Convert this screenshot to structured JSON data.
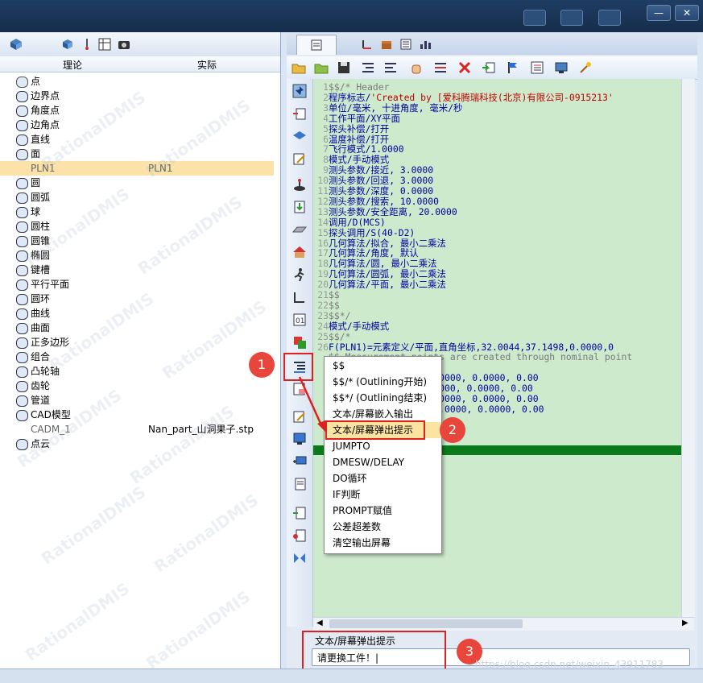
{
  "window": {
    "minimize": "—",
    "close": "✕"
  },
  "tree": {
    "col_theory": "理论",
    "col_actual": "实际",
    "rows": [
      {
        "label": "点",
        "actual": "",
        "indent": 0
      },
      {
        "label": "边界点",
        "actual": "",
        "indent": 0
      },
      {
        "label": "角度点",
        "actual": "",
        "indent": 0
      },
      {
        "label": "边角点",
        "actual": "",
        "indent": 0
      },
      {
        "label": "直线",
        "actual": "",
        "indent": 0
      },
      {
        "label": "面",
        "actual": "",
        "indent": 0
      },
      {
        "label": "PLN1",
        "actual": "PLN1",
        "indent": 1
      },
      {
        "label": "圆",
        "actual": "",
        "indent": 0
      },
      {
        "label": "圆弧",
        "actual": "",
        "indent": 0
      },
      {
        "label": "球",
        "actual": "",
        "indent": 0
      },
      {
        "label": "圆柱",
        "actual": "",
        "indent": 0
      },
      {
        "label": "圆锥",
        "actual": "",
        "indent": 0
      },
      {
        "label": "椭圆",
        "actual": "",
        "indent": 0
      },
      {
        "label": "键槽",
        "actual": "",
        "indent": 0
      },
      {
        "label": "平行平面",
        "actual": "",
        "indent": 0
      },
      {
        "label": "圆环",
        "actual": "",
        "indent": 0
      },
      {
        "label": "曲线",
        "actual": "",
        "indent": 0
      },
      {
        "label": "曲面",
        "actual": "",
        "indent": 0
      },
      {
        "label": "正多边形",
        "actual": "",
        "indent": 0
      },
      {
        "label": "组合",
        "actual": "",
        "indent": 0
      },
      {
        "label": "凸轮轴",
        "actual": "",
        "indent": 0
      },
      {
        "label": "齿轮",
        "actual": "",
        "indent": 0
      },
      {
        "label": "管道",
        "actual": "",
        "indent": 0
      },
      {
        "label": "CAD模型",
        "actual": "",
        "indent": 0
      },
      {
        "label": "CADM_1",
        "actual": "Nan_part_山洞果子.stp",
        "indent": 1
      },
      {
        "label": "点云",
        "actual": "",
        "indent": 0
      }
    ],
    "watermark": "RationalDMIS"
  },
  "editor": {
    "lines": [
      {
        "n": "1",
        "t": "$$/*  Header",
        "cls": "cmt"
      },
      {
        "n": "2",
        "t": "程序标志/",
        "s": "'Created by [爱科腾瑞科技(北京)有限公司-0915213'",
        "cls": "code"
      },
      {
        "n": "3",
        "t": "单位/毫米, 十进角度, 毫米/秒",
        "cls": "code"
      },
      {
        "n": "4",
        "t": "工作平面/XY平面",
        "cls": "code"
      },
      {
        "n": "5",
        "t": "探头补偿/打开",
        "cls": "code"
      },
      {
        "n": "6",
        "t": "温度补偿/打开",
        "cls": "code"
      },
      {
        "n": "7",
        "t": "飞行模式/1.0000",
        "cls": "code"
      },
      {
        "n": "8",
        "t": "模式/手动模式",
        "cls": "code"
      },
      {
        "n": "9",
        "t": "测头参数/接近, 3.0000",
        "cls": "code"
      },
      {
        "n": "10",
        "t": "测头参数/回退, 3.0000",
        "cls": "code"
      },
      {
        "n": "11",
        "t": "测头参数/深度, 0.0000",
        "cls": "code"
      },
      {
        "n": "12",
        "t": "测头参数/搜索, 10.0000",
        "cls": "code"
      },
      {
        "n": "13",
        "t": "测头参数/安全距离, 20.0000",
        "cls": "code"
      },
      {
        "n": "14",
        "t": "调用/D(MCS)",
        "cls": "code"
      },
      {
        "n": "15",
        "t": "探头调用/S(40-D2)",
        "cls": "code"
      },
      {
        "n": "16",
        "t": "几何算法/拟合, 最小二乘法",
        "cls": "code"
      },
      {
        "n": "17",
        "t": "几何算法/角度, 默认",
        "cls": "code"
      },
      {
        "n": "18",
        "t": "几何算法/圆, 最小二乘法",
        "cls": "code"
      },
      {
        "n": "19",
        "t": "几何算法/圆弧, 最小二乘法",
        "cls": "code"
      },
      {
        "n": "20",
        "t": "几何算法/平面, 最小二乘法",
        "cls": "code"
      },
      {
        "n": "21",
        "t": "$$",
        "cls": "cmt"
      },
      {
        "n": "22",
        "t": "$$",
        "cls": "cmt"
      },
      {
        "n": "23",
        "t": "$$*/",
        "cls": "cmt"
      },
      {
        "n": "24",
        "t": "模式/手动模式",
        "cls": "code"
      },
      {
        "n": "25",
        "t": "$$/*",
        "cls": "cmt"
      },
      {
        "n": "26",
        "t": "F(PLN1)=元素定义/平面,直角坐标,32.0044,37.1498,0.0000,0",
        "cls": "code"
      },
      {
        "n": "",
        "t": "$$ Measurement points are created through nominal point",
        "cls": "cmt"
      },
      {
        "n": "",
        "t": "   ), 4",
        "cls": "code"
      },
      {
        "n": "",
        "t": "   2.0569, 61.3288, 0.0000, 0.0000, 0.00",
        "cls": "code"
      },
      {
        "n": "",
        "t": "   3.3371,  9.4121, 0.0000, 0.0000, 0.00",
        "cls": "code"
      },
      {
        "n": "",
        "t": "   59.2959,  5.2117, 0.0000, 0.0000, 0.00",
        "cls": "code"
      },
      {
        "n": "",
        "t": "   63.3278, 72.6466, 0.0000, 0.0000, 0.00",
        "cls": "code"
      },
      {
        "n": "",
        "t": "",
        "cls": "code"
      },
      {
        "n": "",
        "t": "",
        "cls": "code"
      },
      {
        "n": "",
        "t": "",
        "s": "  果子'",
        "cls": "code"
      }
    ]
  },
  "context_menu": {
    "items": [
      "$$",
      "$$/* (Outlining开始)",
      "$$*/ (Outlining结束)",
      "文本/屏幕嵌入输出",
      "文本/屏幕弹出提示",
      "JUMPTO",
      "DMESW/DELAY",
      "DO循环",
      "IF判断",
      "PROMPT赋值",
      "公差超差数",
      "清空输出屏幕"
    ],
    "highlighted_index": 4
  },
  "status": {
    "label": "文本/屏幕弹出提示",
    "input_value": "请更换工件！|"
  },
  "callouts": [
    "1",
    "2",
    "3"
  ],
  "footer_watermark": "https://blog.csdn.net/weixin_43911783",
  "colors": {
    "editor_bg": "#cdeacd",
    "highlight": "#fbe3a2",
    "callout_red": "#e8453c",
    "current_line": "#0a7a1a"
  }
}
